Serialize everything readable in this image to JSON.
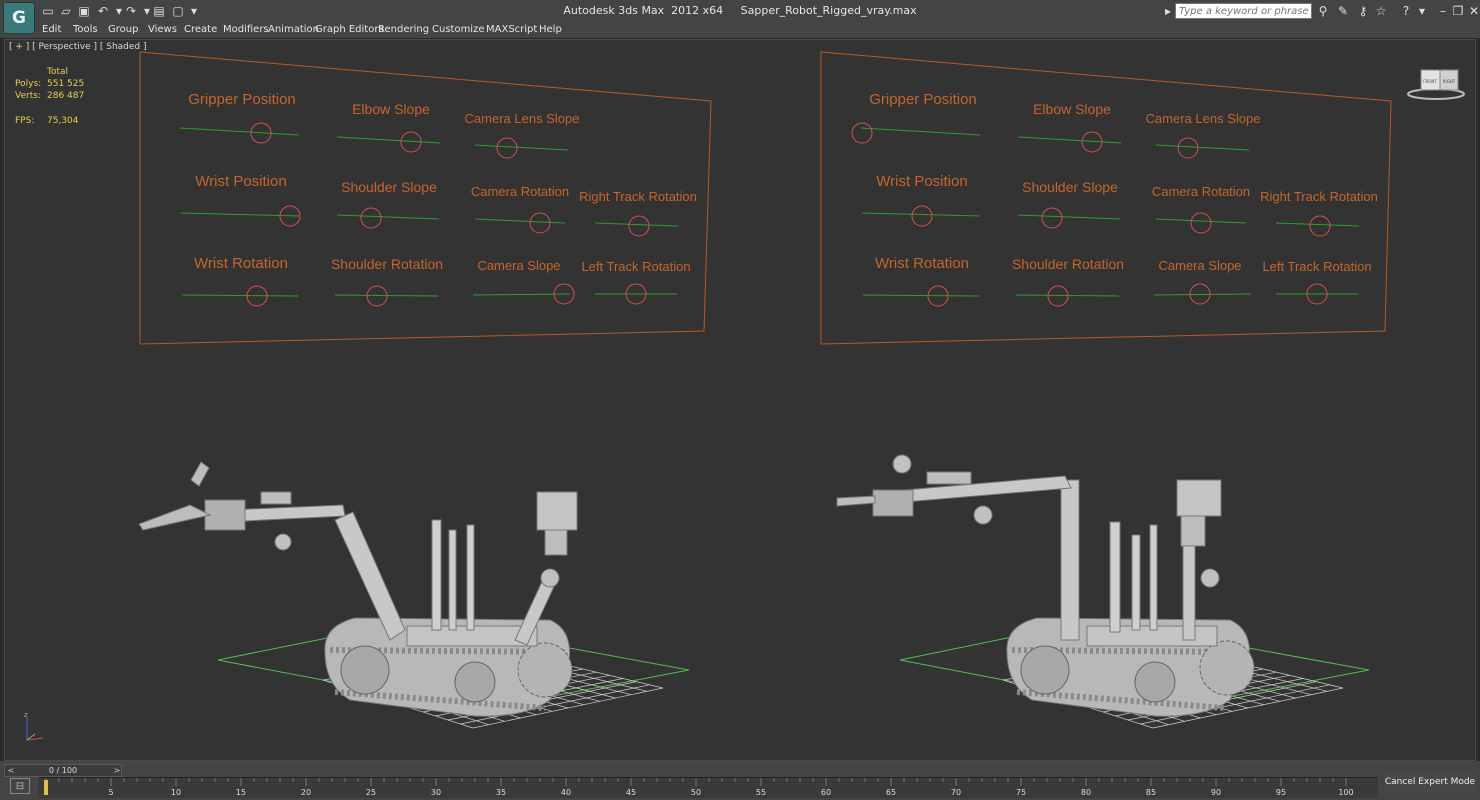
{
  "app": {
    "logo_label": "G",
    "title": "Autodesk 3ds Max  2012 x64     Sapper_Robot_Rigged_vray.max",
    "search_placeholder": "Type a keyword or phrase"
  },
  "quick_access": [
    {
      "name": "new-file-icon",
      "glyph": "▭"
    },
    {
      "name": "open-file-icon",
      "glyph": "▱"
    },
    {
      "name": "save-file-icon",
      "glyph": "▣"
    },
    {
      "name": "undo-icon",
      "glyph": "↶"
    },
    {
      "name": "undo-dropdown-icon",
      "glyph": "▾"
    },
    {
      "name": "redo-icon",
      "glyph": "↷"
    },
    {
      "name": "redo-dropdown-icon",
      "glyph": "▾"
    },
    {
      "name": "project-folder-icon",
      "glyph": "▤"
    },
    {
      "name": "reference-coord-icon",
      "glyph": "▢"
    },
    {
      "name": "quick-access-menu-icon",
      "glyph": "▾"
    }
  ],
  "right_icons": [
    {
      "name": "expand-arrow-icon",
      "glyph": "▸"
    },
    {
      "name": "binoculars-icon",
      "glyph": "⚲"
    },
    {
      "name": "tools-icon",
      "glyph": "✎"
    },
    {
      "name": "key-icon",
      "glyph": "⚷"
    },
    {
      "name": "favorites-star-icon",
      "glyph": "☆"
    },
    {
      "name": "help-icon",
      "glyph": "?"
    },
    {
      "name": "help-dropdown-icon",
      "glyph": "▾"
    },
    {
      "name": "minimize-window-icon",
      "glyph": "–"
    },
    {
      "name": "restore-window-icon",
      "glyph": "❐"
    },
    {
      "name": "close-window-icon",
      "glyph": "✕"
    }
  ],
  "menu": [
    "Edit",
    "Tools",
    "Group",
    "Views",
    "Create",
    "Modifiers",
    "Animation",
    "Graph Editors",
    "Rendering",
    "Customize",
    "MAXScript",
    "Help"
  ],
  "viewport": {
    "label": "[ + ] [ Perspective ] [ Shaded ]",
    "stats": {
      "total_label": "Total",
      "polys_label": "Polys:",
      "polys_value": "551 525",
      "verts_label": "Verts:",
      "verts_value": "286 487",
      "fps_label": "FPS:",
      "fps_value": "75,304"
    },
    "viewcube_labels": {
      "left": "FRONT",
      "right": "RIGHT"
    }
  },
  "control_labels": [
    [
      "Gripper Position",
      "Elbow Slope",
      "Camera Lens Slope"
    ],
    [
      "Wrist Position",
      "Shoulder Slope",
      "Camera Rotation",
      "Right Track Rotation"
    ],
    [
      "Wrist Rotation",
      "Shoulder Rotation",
      "Camera Slope",
      "Left Track Rotation"
    ]
  ],
  "timeline": {
    "frame_display": "0 / 100",
    "prev_arrow": "<",
    "next_arrow": ">",
    "ticks": [
      "5",
      "10",
      "15",
      "20",
      "25",
      "30",
      "35",
      "40",
      "45",
      "50",
      "55",
      "60",
      "65",
      "70",
      "75",
      "80",
      "85",
      "90",
      "95",
      "100"
    ],
    "cancel_expert_label": "Cancel Expert Mode",
    "mini_curve_icon_glyph": "⊟"
  },
  "colors": {
    "label_orange": "#c8642a",
    "frame_orange": "#b75a1f",
    "slider_green": "#2aa02a",
    "grid_green": "#4fc04f",
    "stats_yellow": "#e4d24a"
  }
}
